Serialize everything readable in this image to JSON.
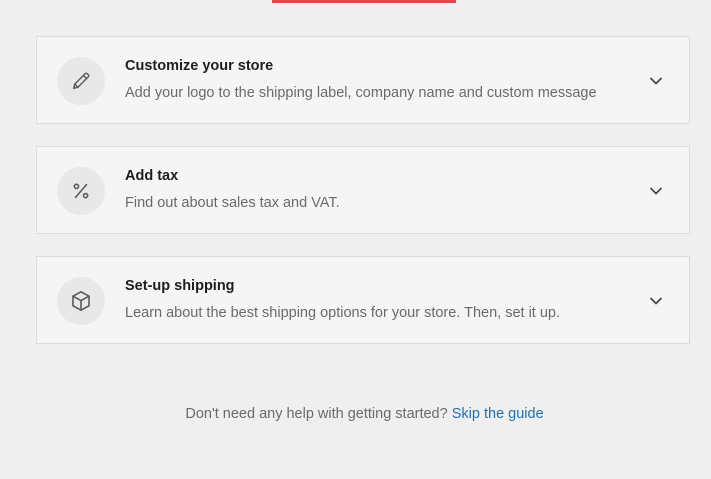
{
  "colors": {
    "background": "#efefef",
    "card_background": "#f5f5f5",
    "accent_red": "#e8444c",
    "link_blue": "#1f6fb3"
  },
  "cards": [
    {
      "icon": "pencil-icon",
      "title": "Customize your store",
      "description": "Add your logo to the shipping label, company name and custom message"
    },
    {
      "icon": "percent-icon",
      "title": "Add tax",
      "description": "Find out about sales tax and VAT."
    },
    {
      "icon": "box-icon",
      "title": "Set-up shipping",
      "description": "Learn about the best shipping options for your store. Then, set it up."
    }
  ],
  "footer": {
    "text": "Don't need any help with getting started?",
    "link_label": "Skip the guide"
  }
}
